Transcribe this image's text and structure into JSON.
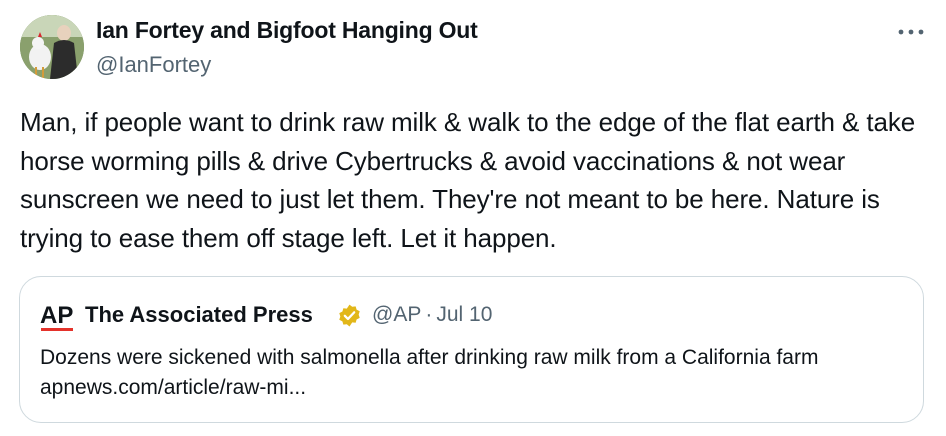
{
  "author": {
    "display_name": "Ian Fortey and Bigfoot Hanging Out",
    "handle": "@IanFortey",
    "avatar_icon": "profile-photo"
  },
  "menu_icon": "more-horizontal-icon",
  "tweet": {
    "text": "Man, if people want to drink raw milk & walk to the edge of the flat earth & take horse worming pills & drive Cybertrucks & avoid vaccinations & not wear sunscreen we need to just let them. They're not meant to be here. Nature is trying to ease them off stage left. Let it happen."
  },
  "quoted_tweet": {
    "logo_text": "AP",
    "display_name": "The Associated Press",
    "verified_badge": "gold-verified-badge-icon",
    "handle": "@AP",
    "separator": "·",
    "date": "Jul 10",
    "text": "Dozens were sickened with salmonella after drinking raw milk from a California farm apnews.com/article/raw-mi...",
    "colors": {
      "logo_red": "#e4322b",
      "badge_gold": "#e2b719"
    }
  },
  "colors": {
    "text_primary": "#0f1419",
    "text_secondary": "#536471",
    "border": "#cfd9de"
  }
}
